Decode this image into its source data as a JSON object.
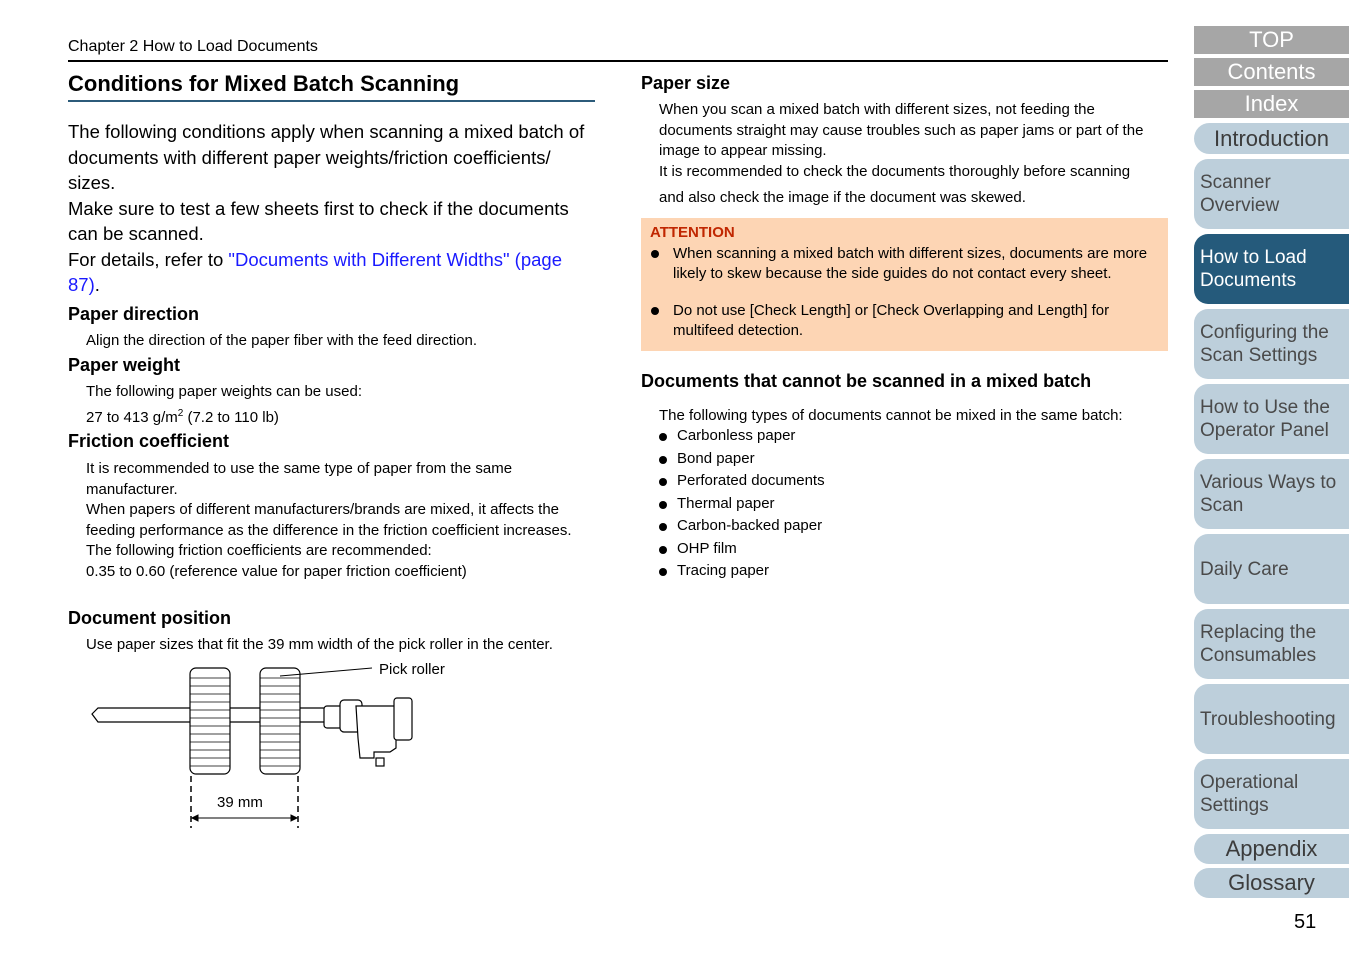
{
  "header": {
    "chapter": "Chapter 2 How to Load Documents",
    "title": "Conditions for Mixed Batch Scanning"
  },
  "intro": {
    "p1": "The following conditions apply when scanning a mixed batch of documents with different paper weights/friction coefficients/ sizes.",
    "p2": "Make sure to test a few sheets first to check if the documents can be scanned.",
    "p3_prefix": "For details, refer to ",
    "p3_link": "\"Documents with Different Widths\" (page 87)",
    "p3_suffix": "."
  },
  "sections": {
    "paper_direction": {
      "heading": "Paper direction",
      "text": "Align the direction of the paper fiber with the feed direction."
    },
    "paper_weight": {
      "heading": "Paper weight",
      "line1": "The following paper weights can be used:",
      "line2_pre": "27 to 413 g/m",
      "line2_sup": "2",
      "line2_post": " (7.2 to 110 lb)"
    },
    "friction": {
      "heading": "Friction coefficient",
      "p1": "It is recommended to use the same type of paper from the same manufacturer.",
      "p2": "When papers of different manufacturers/brands are mixed, it affects the feeding performance as the difference in the friction coefficient increases.",
      "p3": "The following friction coefficients are recommended:",
      "p4": "0.35 to 0.60 (reference value for paper friction coefficient)"
    },
    "document_position": {
      "heading": "Document position",
      "text": "Use paper sizes that fit the 39 mm width of the pick roller in the center.",
      "figure_label": "Pick roller",
      "figure_dimension": "39 mm"
    },
    "paper_size": {
      "heading": "Paper size",
      "p1": "When you scan a mixed batch with different sizes, not feeding the documents straight may cause troubles such as paper jams or part of the image to appear missing.",
      "p2a": "It is recommended to check the documents thoroughly before scanning",
      "p2b": "and also check the image if the document was skewed."
    },
    "attention": {
      "label": "ATTENTION",
      "items": [
        "When scanning a mixed batch with different sizes, documents are more likely to skew because the side guides do not contact every sheet.",
        "Do not use [Check Length] or [Check Overlapping and Length] for multifeed detection."
      ]
    },
    "cannot_mix": {
      "heading": "Documents that cannot be scanned in a mixed batch",
      "intro": "The following types of documents cannot be mixed in the same batch:",
      "items": [
        "Carbonless paper",
        "Bond paper",
        "Perforated documents",
        "Thermal paper",
        "Carbon-backed paper",
        "OHP film",
        "Tracing paper"
      ]
    }
  },
  "sidebar": {
    "top": "TOP",
    "contents": "Contents",
    "index": "Index",
    "introduction": "Introduction",
    "tabs": [
      "Scanner Overview",
      "How to Load Documents",
      "Configuring the Scan Settings",
      "How to Use the Operator Panel",
      "Various Ways to Scan",
      "Daily Care",
      "Replacing the Consumables",
      "Troubleshooting",
      "Operational Settings"
    ],
    "appendix": "Appendix",
    "glossary": "Glossary",
    "active_tab": "How to Load Documents"
  },
  "colors": {
    "accent": "#255a7b",
    "tab_bg": "#bdcfdb",
    "attention_bg": "#fdd5b4",
    "attention_label": "#c02600",
    "link": "#1a1aff"
  },
  "footer": {
    "page_number": "51"
  }
}
